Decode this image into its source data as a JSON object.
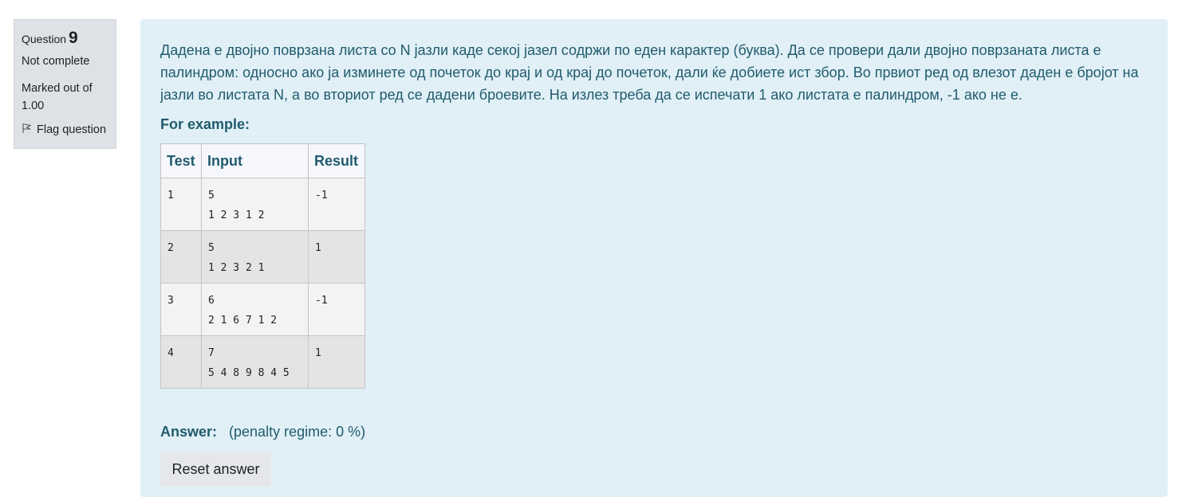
{
  "info": {
    "question_prefix": "Question",
    "question_number": "9",
    "state": "Not complete",
    "grade": "Marked out of 1.00",
    "flag_label": "Flag question"
  },
  "question": {
    "text": "Дадена е двојно поврзана листа со N јазли каде секој јазел содржи по еден карактер (буква). Да се провери дали двојно поврзаната листа е палиндром: односно ако ја изминете од почеток до крај и од крај до почеток, дали ќе добиете ист збор. Во првиот ред од влезот даден е бројот на јазли во листата N, а во вториот ред се дадени броевите. На излез треба да се испечати 1 ако листата е палиндром, -1 ако не е.",
    "for_example": "For example:",
    "table": {
      "headers": [
        "Test",
        "Input",
        "Result"
      ],
      "rows": [
        {
          "test": "1",
          "input_line1": "5",
          "input_line2": "1 2 3 1 2",
          "result": "-1"
        },
        {
          "test": "2",
          "input_line1": "5",
          "input_line2": "1 2 3 2 1",
          "result": "1"
        },
        {
          "test": "3",
          "input_line1": "6",
          "input_line2": "2 1 6 7 1 2",
          "result": "-1"
        },
        {
          "test": "4",
          "input_line1": "7",
          "input_line2": "5 4 8 9 8 4 5",
          "result": "1"
        }
      ]
    }
  },
  "answer": {
    "label": "Answer:",
    "penalty": "(penalty regime: 0 %)",
    "reset_label": "Reset answer"
  }
}
